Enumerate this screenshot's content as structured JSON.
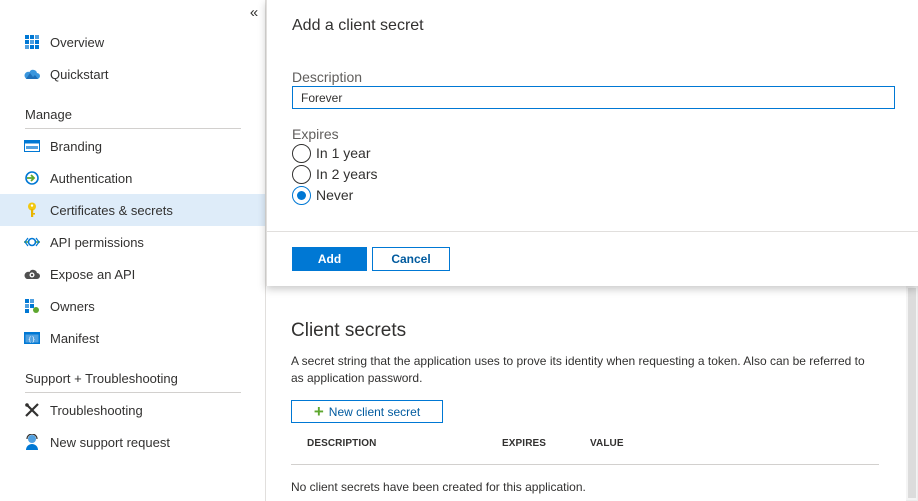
{
  "sidebar": {
    "collapse_glyph": "«",
    "items_top": [
      {
        "label": "Overview",
        "icon": "overview-grid-icon"
      },
      {
        "label": "Quickstart",
        "icon": "cloud-quickstart-icon"
      }
    ],
    "manage_title": "Manage",
    "items_manage": [
      {
        "label": "Branding",
        "icon": "branding-www-icon"
      },
      {
        "label": "Authentication",
        "icon": "authentication-icon"
      },
      {
        "label": "Certificates & secrets",
        "icon": "key-icon",
        "active": true
      },
      {
        "label": "API permissions",
        "icon": "api-permissions-icon"
      },
      {
        "label": "Expose an API",
        "icon": "cloud-gear-icon"
      },
      {
        "label": "Owners",
        "icon": "owners-icon"
      },
      {
        "label": "Manifest",
        "icon": "manifest-icon"
      }
    ],
    "support_title": "Support + Troubleshooting",
    "items_support": [
      {
        "label": "Troubleshooting",
        "icon": "troubleshooting-tools-icon"
      },
      {
        "label": "New support request",
        "icon": "support-person-icon"
      }
    ]
  },
  "panel": {
    "title": "Add a client secret",
    "description_label": "Description",
    "description_value": "Forever",
    "expires_label": "Expires",
    "options": [
      {
        "label": "In 1 year",
        "checked": false
      },
      {
        "label": "In 2 years",
        "checked": false
      },
      {
        "label": "Never",
        "checked": true
      }
    ],
    "add_label": "Add",
    "cancel_label": "Cancel"
  },
  "client_secrets": {
    "title": "Client secrets",
    "description": "A secret string that the application uses to prove its identity when requesting a token. Also can be referred to as application password.",
    "new_button_label": "New client secret",
    "columns": [
      "DESCRIPTION",
      "EXPIRES",
      "VALUE"
    ],
    "empty_message": "No client secrets have been created for this application."
  },
  "colors": {
    "accent": "#0078d4",
    "active_nav_bg": "#deecf9",
    "plus_green": "#5ea72f"
  }
}
